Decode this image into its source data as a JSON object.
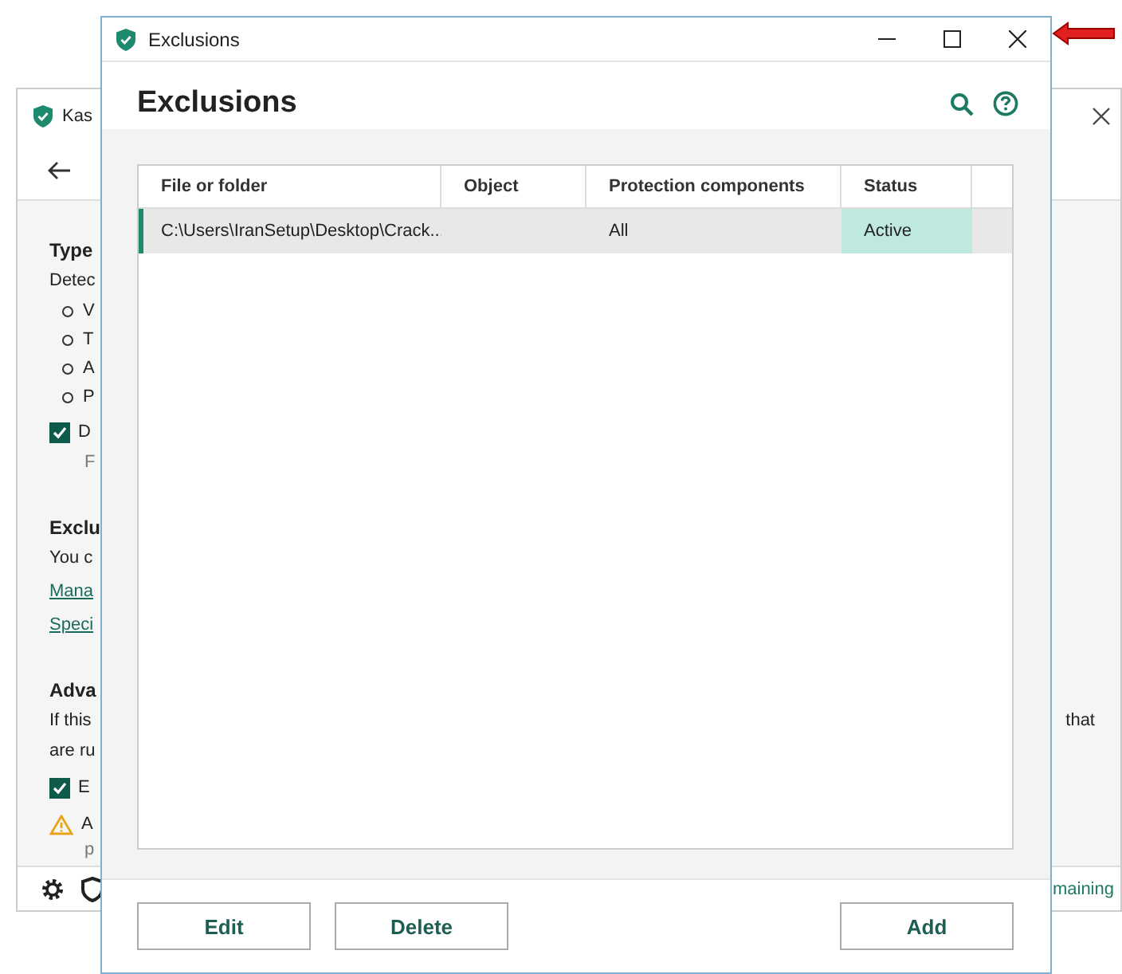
{
  "background_window": {
    "title": "Kas",
    "heading_1": "Type",
    "text_1": "Detec",
    "bullets": [
      "V",
      "T",
      "A",
      "P"
    ],
    "checkbox_1": {
      "label": "D",
      "checked": true
    },
    "hint_1": "F",
    "heading_2": "Exclu",
    "text_2": "You c",
    "links": [
      "Mana",
      "Speci"
    ],
    "heading_3": "Adva",
    "text_3": "If this",
    "text_3_right": "that",
    "text_4": "are ru",
    "checkbox_2": {
      "label": "E",
      "checked": true
    },
    "warning": {
      "text": "A",
      "subtext": "p"
    },
    "status_text": "maining"
  },
  "dialog": {
    "window_title": "Exclusions",
    "heading": "Exclusions",
    "table": {
      "columns": [
        "File or folder",
        "Object",
        "Protection components",
        "Status"
      ],
      "rows": [
        {
          "file_or_folder": "C:\\Users\\IranSetup\\Desktop\\Crack...",
          "object": "",
          "protection_components": "All",
          "status": "Active",
          "selected": true
        }
      ]
    },
    "buttons": [
      "Edit",
      "Delete",
      "Add"
    ]
  }
}
